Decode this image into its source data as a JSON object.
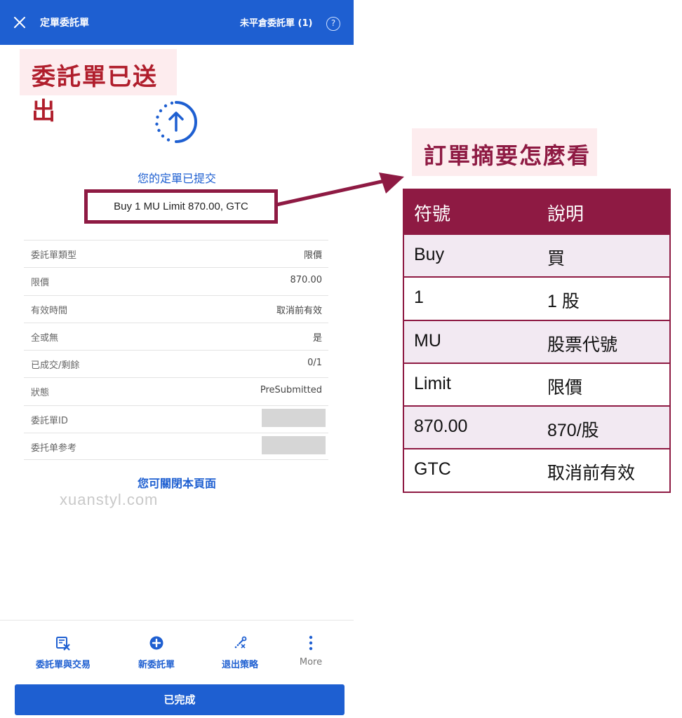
{
  "app": {
    "header": {
      "title": "定單委託單",
      "open_orders_label": "未平倉委託單 (1)",
      "help_symbol": "?"
    },
    "confirmation": {
      "status_text": "您的定單已提交",
      "order_summary": "Buy 1 MU Limit 870.00, GTC",
      "close_hint": "您可關閉本頁面"
    },
    "details": [
      {
        "label": "委託單類型",
        "value": "限價"
      },
      {
        "label": "限價",
        "value": "870.00"
      },
      {
        "label": "有效時間",
        "value": "取消前有效"
      },
      {
        "label": "全或無",
        "value": "是"
      },
      {
        "label": "已成交/剩餘",
        "value": "0/1"
      },
      {
        "label": "狀態",
        "value": "PreSubmitted"
      },
      {
        "label": "委託單ID",
        "value": null,
        "redacted": true
      },
      {
        "label": "委托单参考",
        "value": null,
        "redacted": true
      }
    ],
    "bottom_nav": [
      {
        "label": "委託單與交易",
        "icon": "orders-trades-icon"
      },
      {
        "label": "新委託單",
        "icon": "plus-circle-icon"
      },
      {
        "label": "退出策略",
        "icon": "exit-strategy-icon"
      },
      {
        "label": "More",
        "icon": "more-vertical-icon"
      }
    ],
    "done_button_label": "已完成"
  },
  "annotations": {
    "order_sent_title": "委託單已送出",
    "howto_title": "訂單摘要怎麼看",
    "watermark": "xuanstyl.com",
    "legend_table": {
      "headers": [
        "符號",
        "說明"
      ],
      "rows": [
        [
          "Buy",
          "買"
        ],
        [
          "1",
          "1 股"
        ],
        [
          "MU",
          "股票代號"
        ],
        [
          "Limit",
          "限價"
        ],
        [
          "870.00",
          "870/股"
        ],
        [
          "GTC",
          "取消前有效"
        ]
      ]
    }
  },
  "colors": {
    "primary_blue": "#1e5fd1",
    "annotation_maroon": "#8e1a43",
    "badge_pink": "#fdecee",
    "row_shade": "#f2e9f2"
  }
}
